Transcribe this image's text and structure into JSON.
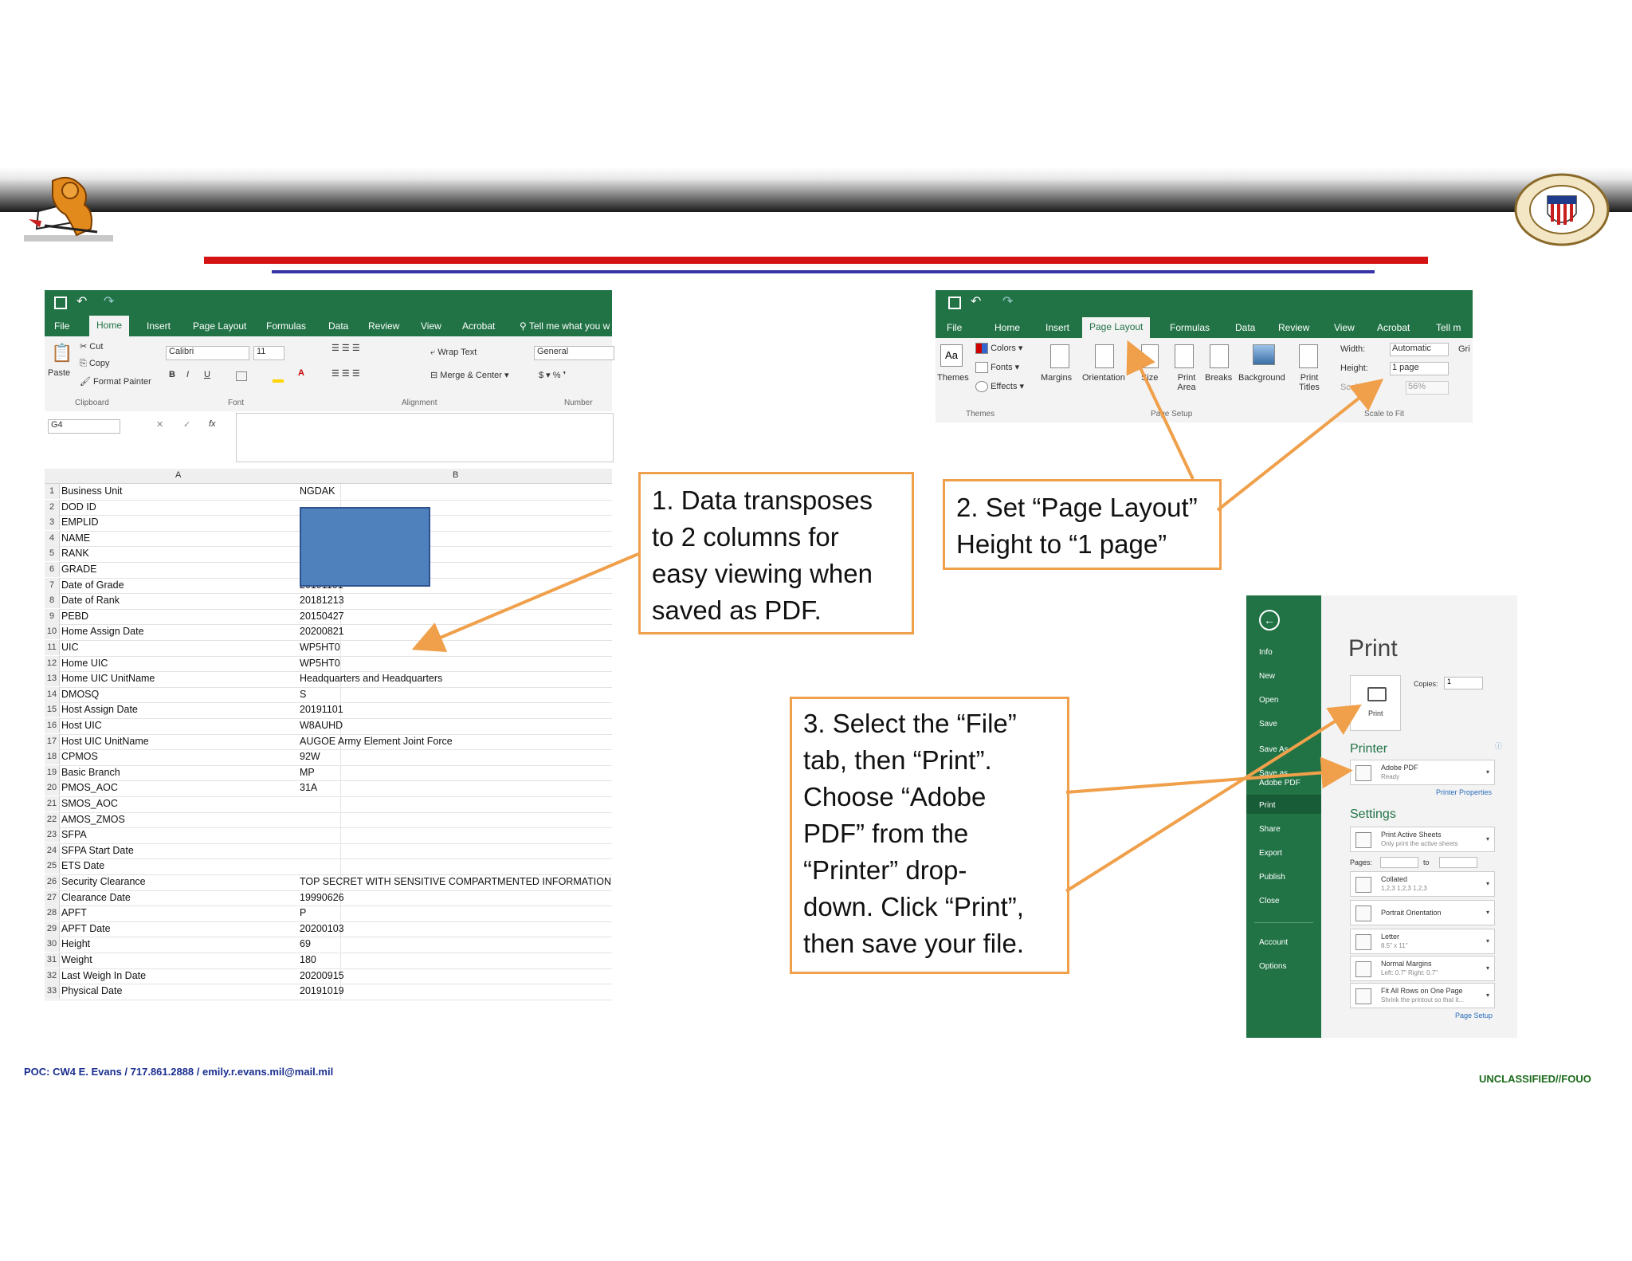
{
  "footer": {
    "poc": "POC: CW4 E. Evans / 717.861.2888 / emily.r.evans.mil@mail.mil",
    "classification": "UNCLASSIFIED//FOUO"
  },
  "logos": {
    "left": "lion-crest-logo",
    "right": "adjutant-general-corps-seal"
  },
  "excel1": {
    "tabs": [
      "File",
      "Home",
      "Insert",
      "Page Layout",
      "Formulas",
      "Data",
      "Review",
      "View",
      "Acrobat"
    ],
    "active_tab": "Home",
    "tell_me": "Tell me what you w",
    "clipboard": {
      "paste": "Paste",
      "cut": "Cut",
      "copy": "Copy",
      "format_painter": "Format Painter",
      "group": "Clipboard"
    },
    "font": {
      "name": "Calibri",
      "size": "11",
      "group": "Font"
    },
    "alignment": {
      "wrap": "Wrap Text",
      "merge": "Merge & Center",
      "group": "Alignment"
    },
    "number": {
      "format": "General",
      "group": "Number"
    },
    "name_box": "G4",
    "fx": "fx",
    "col_a": "A",
    "col_b": "B",
    "rows": [
      {
        "n": "1",
        "a": "Business Unit",
        "b": "NGDAK"
      },
      {
        "n": "2",
        "a": "DOD ID",
        "b": ""
      },
      {
        "n": "3",
        "a": "EMPLID",
        "b": ""
      },
      {
        "n": "4",
        "a": "NAME",
        "b": ""
      },
      {
        "n": "5",
        "a": "RANK",
        "b": ""
      },
      {
        "n": "6",
        "a": "GRADE",
        "b": ""
      },
      {
        "n": "7",
        "a": "Date of Grade",
        "b": "20191101"
      },
      {
        "n": "8",
        "a": "Date of Rank",
        "b": "20181213"
      },
      {
        "n": "9",
        "a": "PEBD",
        "b": "20150427"
      },
      {
        "n": "10",
        "a": "Home Assign Date",
        "b": "20200821"
      },
      {
        "n": "11",
        "a": "UIC",
        "b": "WP5HT0"
      },
      {
        "n": "12",
        "a": "Home UIC",
        "b": "WP5HT0"
      },
      {
        "n": "13",
        "a": "Home UIC UnitName",
        "b": "Headquarters and Headquarters"
      },
      {
        "n": "14",
        "a": "DMOSQ",
        "b": "S"
      },
      {
        "n": "15",
        "a": "Host Assign Date",
        "b": "20191101"
      },
      {
        "n": "16",
        "a": "Host UIC",
        "b": "W8AUHD"
      },
      {
        "n": "17",
        "a": "Host UIC UnitName",
        "b": "AUGOE Army Element Joint Force"
      },
      {
        "n": "18",
        "a": "CPMOS",
        "b": "92W"
      },
      {
        "n": "19",
        "a": "Basic Branch",
        "b": "MP"
      },
      {
        "n": "20",
        "a": "PMOS_AOC",
        "b": "31A"
      },
      {
        "n": "21",
        "a": "SMOS_AOC",
        "b": ""
      },
      {
        "n": "22",
        "a": "AMOS_ZMOS",
        "b": ""
      },
      {
        "n": "23",
        "a": "SFPA",
        "b": ""
      },
      {
        "n": "24",
        "a": "SFPA Start Date",
        "b": ""
      },
      {
        "n": "25",
        "a": "ETS Date",
        "b": ""
      },
      {
        "n": "26",
        "a": "Security Clearance",
        "b": "TOP SECRET WITH SENSITIVE COMPARTMENTED INFORMATION"
      },
      {
        "n": "27",
        "a": "Clearance Date",
        "b": "19990626"
      },
      {
        "n": "28",
        "a": "APFT",
        "b": "P"
      },
      {
        "n": "29",
        "a": "APFT Date",
        "b": "20200103"
      },
      {
        "n": "30",
        "a": "Height",
        "b": "69"
      },
      {
        "n": "31",
        "a": "Weight",
        "b": "180"
      },
      {
        "n": "32",
        "a": "Last Weigh In Date",
        "b": "20200915"
      },
      {
        "n": "33",
        "a": "Physical Date",
        "b": "20191019"
      }
    ]
  },
  "excel2": {
    "tabs": [
      "File",
      "Home",
      "Insert",
      "Page Layout",
      "Formulas",
      "Data",
      "Review",
      "View",
      "Acrobat",
      "Tell m"
    ],
    "active_tab": "Page Layout",
    "themes": {
      "themes": "Themes",
      "colors": "Colors",
      "fonts": "Fonts",
      "effects": "Effects",
      "group": "Themes"
    },
    "page_setup": {
      "margins": "Margins",
      "orientation": "Orientation",
      "size": "Size",
      "print_area": "Print Area",
      "breaks": "Breaks",
      "background": "Background",
      "print_titles": "Print Titles",
      "group": "Page Setup"
    },
    "scale": {
      "width_label": "Width:",
      "width_val": "Automatic",
      "height_label": "Height:",
      "height_val": "1 page",
      "scale_label": "Scale:",
      "scale_val": "56%",
      "group": "Scale to Fit"
    },
    "gridlines": "Gri"
  },
  "print_panel": {
    "sidebar": [
      "Info",
      "New",
      "Open",
      "Save",
      "Save As",
      "Save as Adobe PDF",
      "Print",
      "Share",
      "Export",
      "Publish",
      "Close",
      "Account",
      "Options"
    ],
    "title": "Print",
    "copies_label": "Copies:",
    "copies_val": "1",
    "print_button": "Print",
    "printer_header": "Printer",
    "printer_name": "Adobe PDF",
    "printer_status": "Ready",
    "printer_props": "Printer Properties",
    "settings_header": "Settings",
    "options": [
      {
        "t1": "Print Active Sheets",
        "t2": "Only print the active sheets"
      },
      {
        "t1": "Collated",
        "t2": "1,2,3    1,2,3    1,2,3"
      },
      {
        "t1": "Portrait Orientation",
        "t2": ""
      },
      {
        "t1": "Letter",
        "t2": "8.5\" x 11\""
      },
      {
        "t1": "Normal Margins",
        "t2": "Left: 0.7\"   Right: 0.7\""
      },
      {
        "t1": "Fit All Rows on One Page",
        "t2": "Shrink the printout so that it..."
      }
    ],
    "pages_label": "Pages:",
    "to_label": "to",
    "page_setup": "Page Setup"
  },
  "callouts": {
    "c1": [
      "1. Data transposes",
      "to 2 columns for",
      "easy viewing when",
      "saved as PDF."
    ],
    "c2": [
      "2. Set “Page Layout”",
      "Height to “1 page”"
    ],
    "c3": [
      "3. Select the “File”",
      "tab, then “Print”.",
      "Choose “Adobe",
      "PDF” from the",
      "“Printer” drop-",
      "down. Click “Print”,",
      "then save your file."
    ]
  },
  "colors": {
    "excel_green": "#217346",
    "callout_orange": "#f0a04b",
    "red_line": "#d41414",
    "blue_line": "#3333a6",
    "redacted_blue": "#4f81bd"
  }
}
